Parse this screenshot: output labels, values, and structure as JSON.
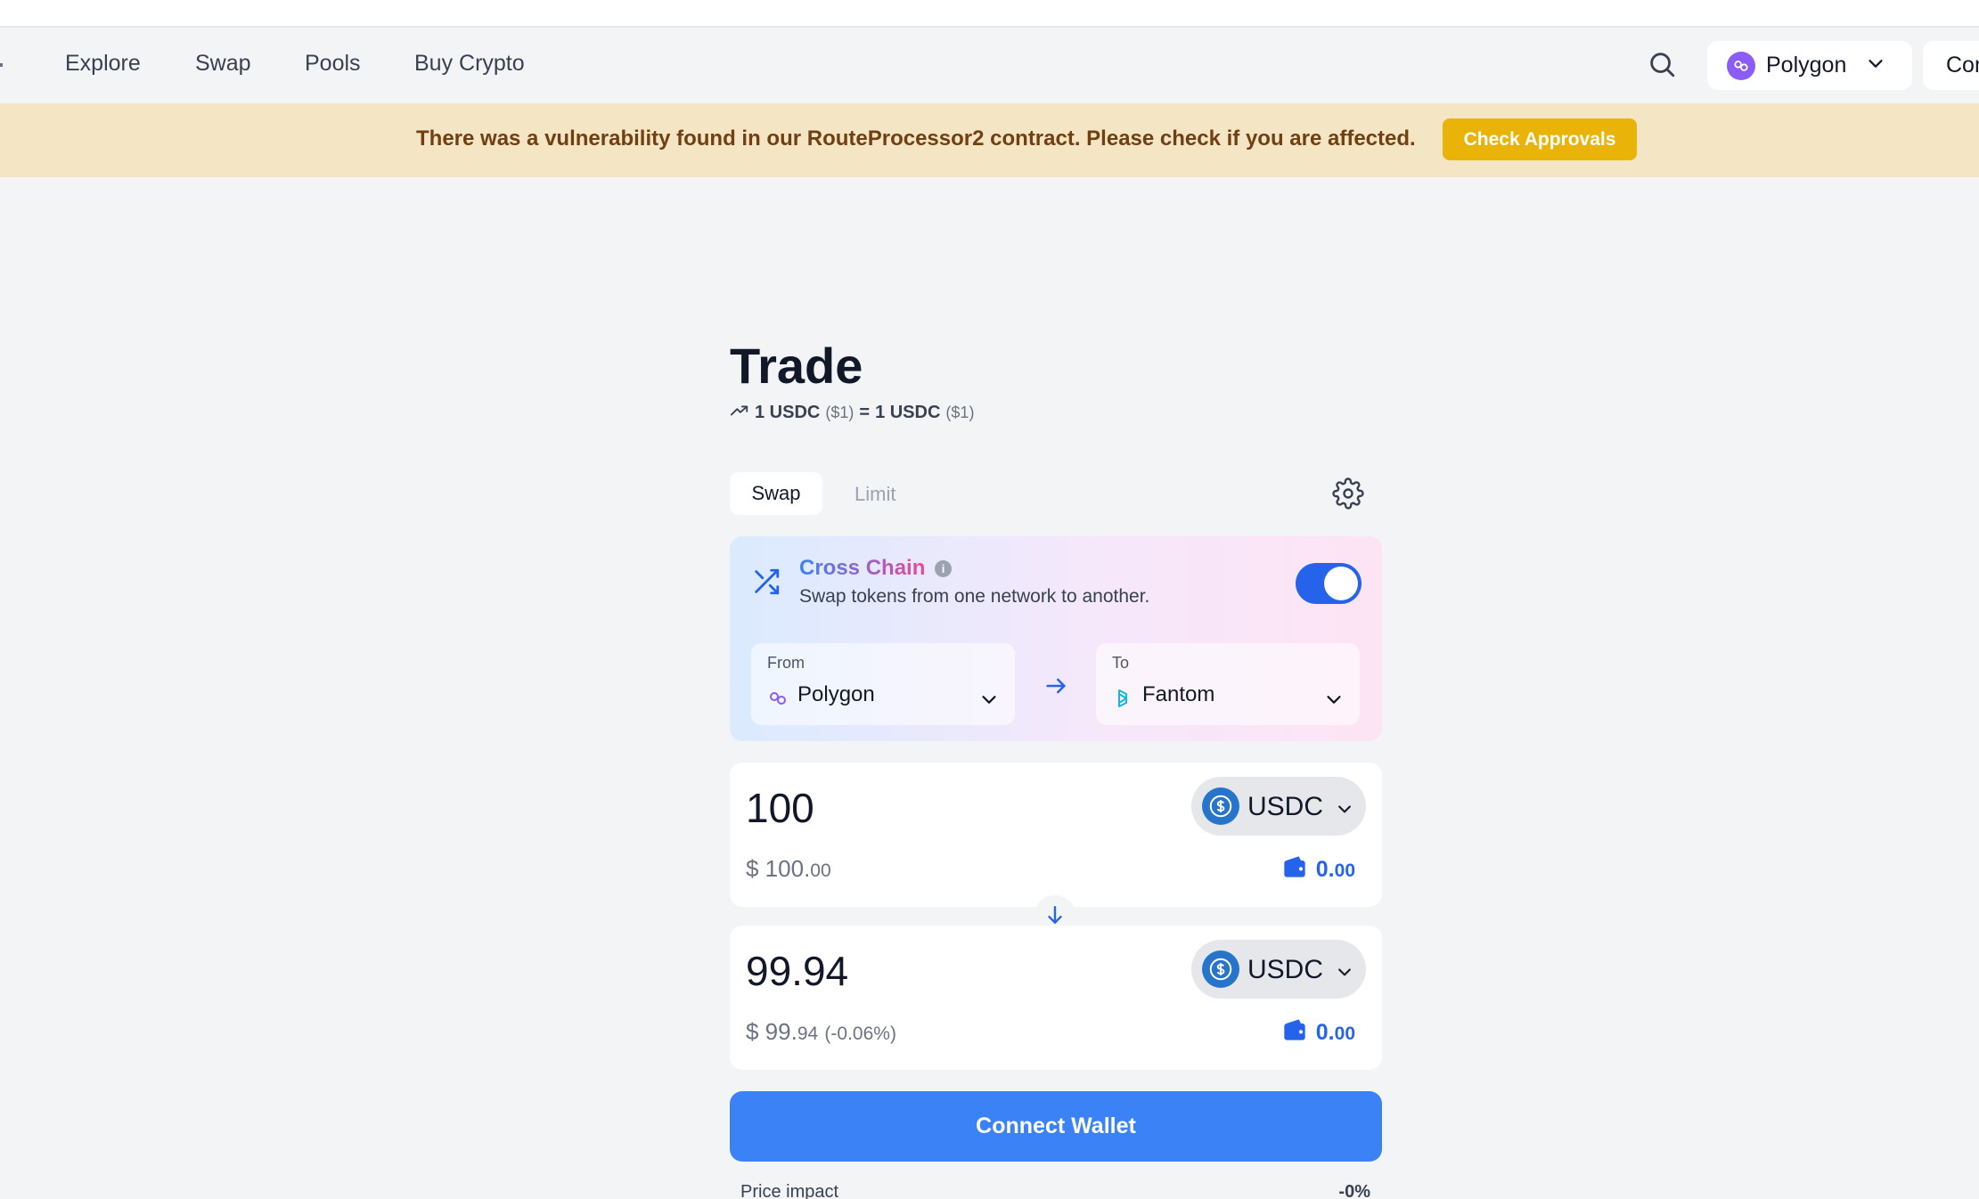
{
  "nav": {
    "links": [
      "Explore",
      "Swap",
      "Pools",
      "Buy Crypto"
    ],
    "network": "Polygon",
    "connect": "Connect"
  },
  "banner": {
    "text": "There was a vulnerability found in our RouteProcessor2 contract. Please check if you are affected.",
    "button": "Check Approvals"
  },
  "trade": {
    "title": "Trade",
    "rate": {
      "from": "1 USDC",
      "from_usd": "($1)",
      "eq": "=",
      "to": "1 USDC",
      "to_usd": "($1)"
    },
    "tabs": {
      "swap": "Swap",
      "limit": "Limit"
    }
  },
  "cross_chain": {
    "title": "Cross Chain",
    "info": "i",
    "subtitle": "Swap tokens from one network to another.",
    "enabled": true,
    "from_label": "From",
    "from_network": "Polygon",
    "to_label": "To",
    "to_network": "Fantom"
  },
  "input_token": {
    "amount": "100",
    "usd_main": "$ 100.",
    "usd_cents": "00",
    "symbol": "USDC",
    "balance_main": "0.",
    "balance_cents": "00"
  },
  "output_token": {
    "amount": "99.94",
    "usd_main": "$ 99.",
    "usd_cents": "94",
    "usd_change": "(-0.06%)",
    "symbol": "USDC",
    "balance_main": "0.",
    "balance_cents": "00"
  },
  "connect_wallet": "Connect Wallet",
  "price_impact": {
    "label": "Price impact",
    "value": "-0%"
  },
  "colors": {
    "accent": "#3b82f6",
    "banner_bg": "#f4e6c5",
    "banner_button": "#eab308",
    "usdc": "#2775ca",
    "polygon": "#8b5cf6",
    "fantom": "#13b5ec"
  },
  "icons": [
    "search-icon",
    "polygon-icon",
    "chevron-down-icon",
    "trend-up-icon",
    "gear-icon",
    "shuffle-icon",
    "info-icon",
    "fantom-icon",
    "arrow-right-icon",
    "usdc-icon",
    "wallet-icon",
    "arrow-down-icon"
  ]
}
